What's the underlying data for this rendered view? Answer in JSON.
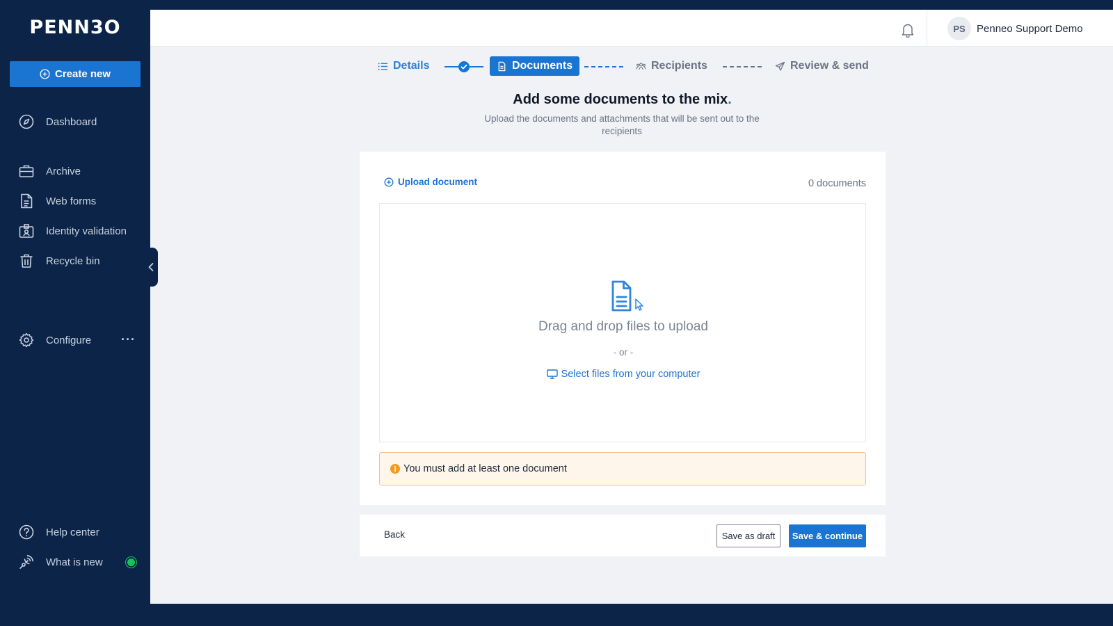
{
  "app": {
    "logo_text": "PENN3O",
    "brand_color": "#1a74d2",
    "sidebar_color": "#0b2447"
  },
  "sidebar": {
    "create_label": "Create new",
    "items": [
      {
        "label": "Dashboard",
        "icon": "compass-icon"
      },
      {
        "label": "Archive",
        "icon": "briefcase-icon"
      },
      {
        "label": "Web forms",
        "icon": "document-icon"
      },
      {
        "label": "Identity validation",
        "icon": "id-badge-icon"
      },
      {
        "label": "Recycle bin",
        "icon": "trash-icon"
      },
      {
        "label": "Configure",
        "icon": "gear-icon"
      },
      {
        "label": "Help center",
        "icon": "help-circle-icon"
      },
      {
        "label": "What is new",
        "icon": "broadcast-icon"
      }
    ],
    "configure_more": "···",
    "whats_new_status_color": "#16c35b"
  },
  "topbar": {
    "avatar_initials": "PS",
    "user_name": "Penneo Support Demo"
  },
  "stepper": {
    "steps": [
      {
        "label": "Details",
        "state": "done"
      },
      {
        "label": "Documents",
        "state": "active"
      },
      {
        "label": "Recipients",
        "state": "pending"
      },
      {
        "label": "Review & send",
        "state": "pending"
      }
    ]
  },
  "page": {
    "heading": "Add some documents to the mix",
    "heading_dot": ".",
    "subheading": "Upload the documents and attachments that will be sent out to the recipients"
  },
  "documents": {
    "upload_link": "Upload document",
    "count_text": "0 documents",
    "dropzone": {
      "main_text": "Drag and drop files to upload",
      "or_text": "- or -",
      "select_text": "Select files from your computer"
    },
    "warning_text": "You must add at least one document"
  },
  "footer": {
    "back_label": "Back",
    "draft_label": "Save as draft",
    "continue_label": "Save & continue"
  }
}
